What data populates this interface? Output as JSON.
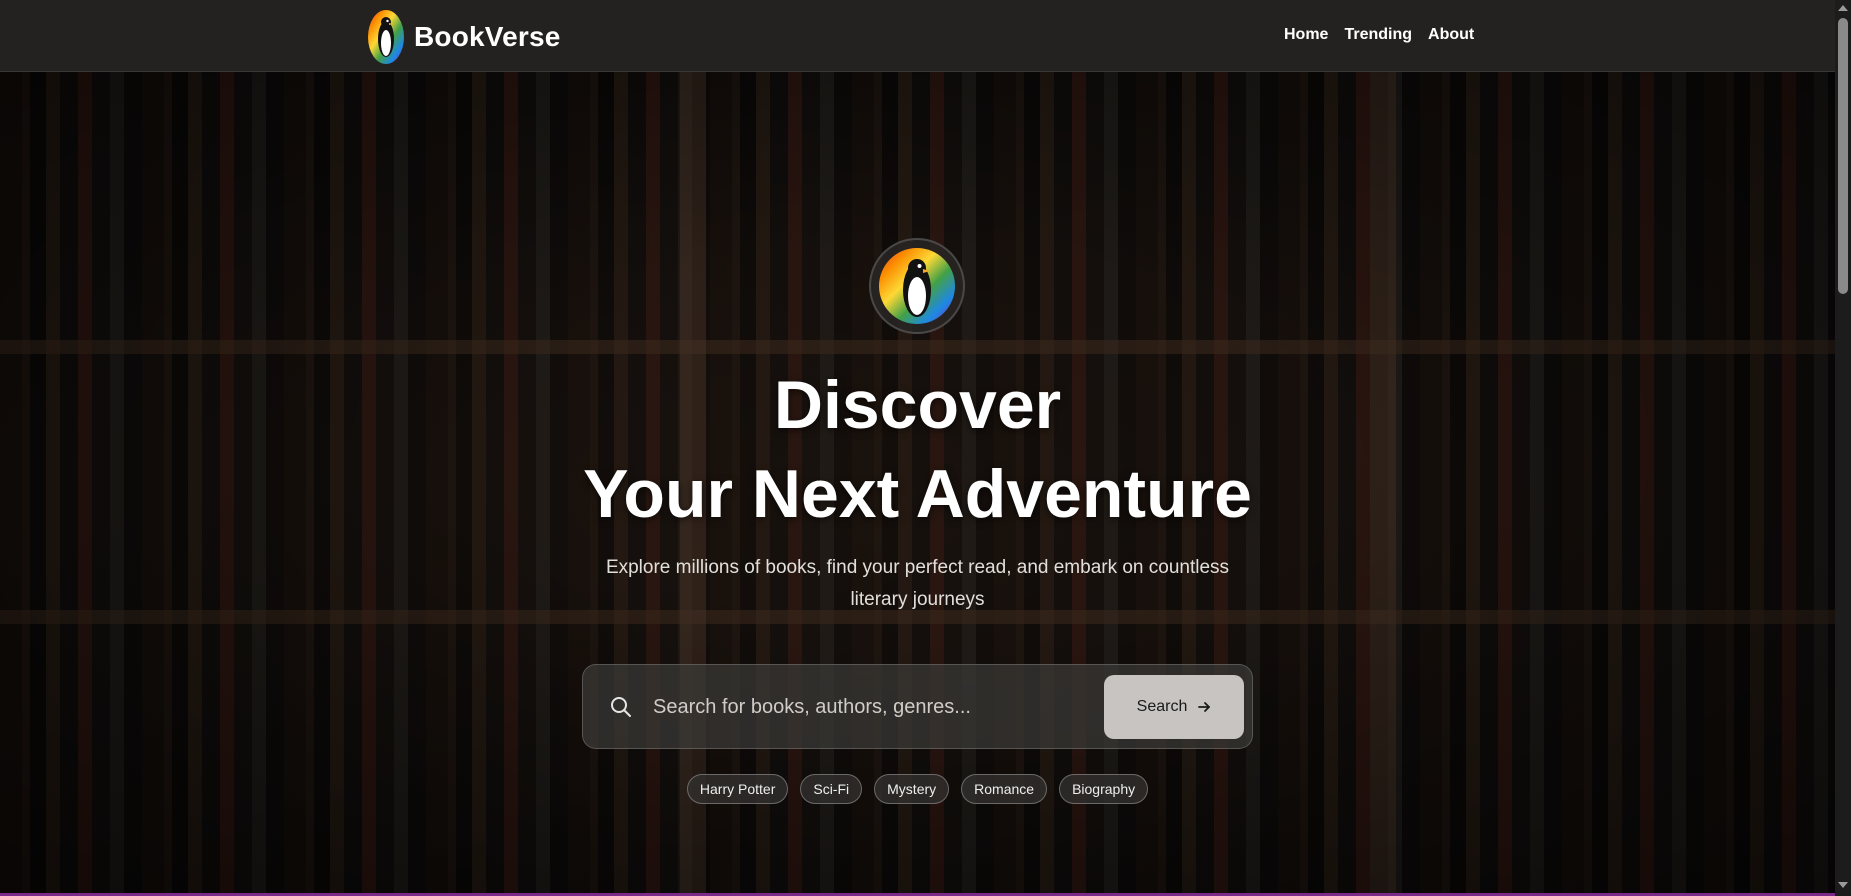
{
  "brand": {
    "name": "BookVerse",
    "logo_icon": "penguin-icon"
  },
  "nav": {
    "links": [
      "Home",
      "Trending",
      "About"
    ]
  },
  "hero": {
    "title_line1": "Discover",
    "title_line2": "Your Next Adventure",
    "subtitle": "Explore millions of books, find your perfect read, and embark on countless literary journeys"
  },
  "search": {
    "placeholder": "Search for books, authors, genres...",
    "value": "",
    "button_label": "Search",
    "icon": "search-icon",
    "button_icon": "arrow-right-icon"
  },
  "tags": [
    "Harry Potter",
    "Sci-Fi",
    "Mystery",
    "Romance",
    "Biography"
  ],
  "colors": {
    "navbar_bg": "#232221",
    "button_bg": "#c7c4c1",
    "accent_bottom": "#7b2a8a"
  }
}
